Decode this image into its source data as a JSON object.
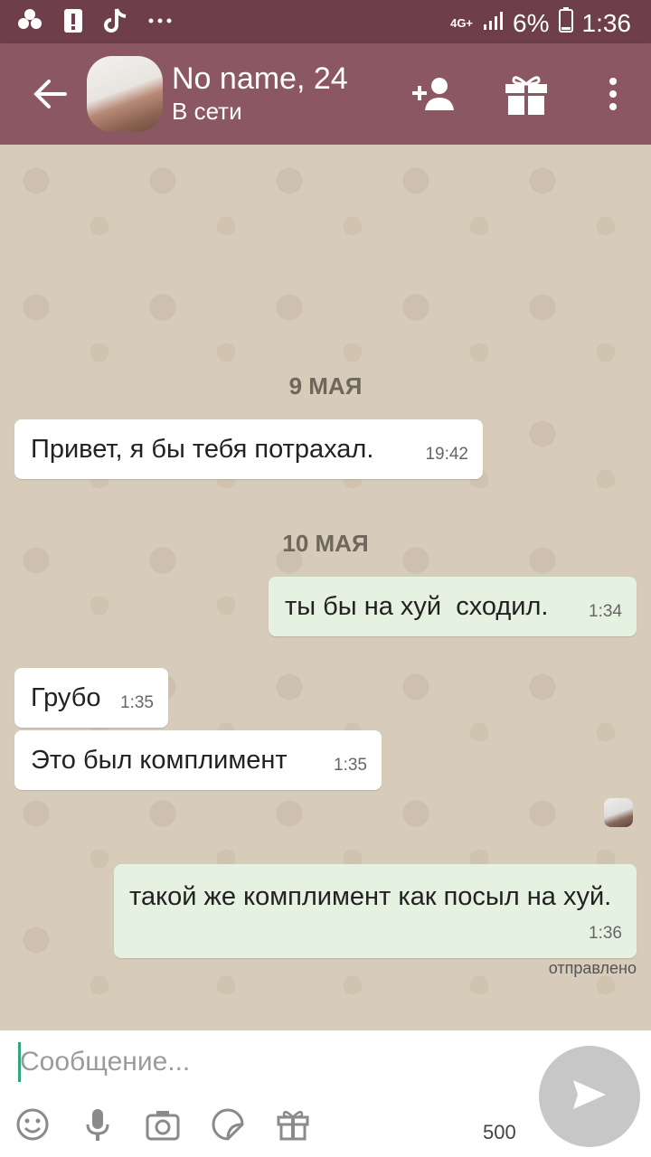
{
  "status_bar": {
    "network": "4G+",
    "battery": "6%",
    "time": "1:36",
    "notification_icons": [
      "pinwheel-icon",
      "alert-icon",
      "tiktok-icon",
      "more-dots-icon"
    ]
  },
  "header": {
    "name": "No name, 24",
    "status": "В сети",
    "colors": {
      "bar": "#8b5762",
      "status_bar": "#6e3f4a"
    }
  },
  "messages": [
    {
      "type": "date",
      "label": "9 МАЯ"
    },
    {
      "type": "in",
      "text": "Привет, я бы тебя потрахал.",
      "time": "19:42"
    },
    {
      "type": "date",
      "label": "10 МАЯ"
    },
    {
      "type": "out",
      "text": "ты бы на хуй  сходил.",
      "time": "1:34"
    },
    {
      "type": "in",
      "text": "Грубо",
      "time": "1:35"
    },
    {
      "type": "in",
      "text": "Это был комплимент",
      "time": "1:35"
    },
    {
      "type": "out",
      "text": "такой же комплимент как посыл на хуй.",
      "time": "1:36"
    }
  ],
  "sent_status": "отправлено",
  "composer": {
    "placeholder": "Сообщение...",
    "counter": "500"
  }
}
